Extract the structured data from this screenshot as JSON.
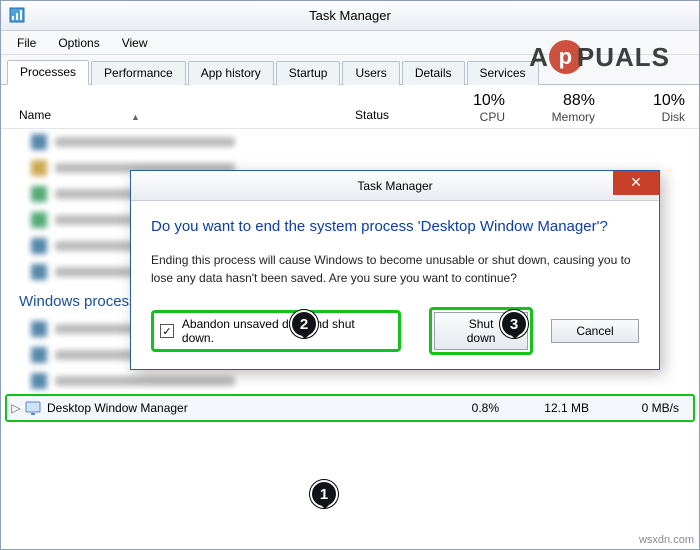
{
  "window": {
    "title": "Task Manager"
  },
  "menu": {
    "file": "File",
    "options": "Options",
    "view": "View"
  },
  "tabs": {
    "processes": "Processes",
    "performance": "Performance",
    "app_history": "App history",
    "startup": "Startup",
    "users": "Users",
    "details": "Details",
    "services": "Services"
  },
  "columns": {
    "name": "Name",
    "status": "Status",
    "cpu": {
      "value": "10%",
      "label": "CPU"
    },
    "memory": {
      "value": "88%",
      "label": "Memory"
    },
    "disk": {
      "value": "10%",
      "label": "Disk"
    }
  },
  "group_label": "Windows processes",
  "selected_process": {
    "name": "Desktop Window Manager",
    "cpu": "0.8%",
    "memory": "12.1 MB",
    "disk": "0 MB/s"
  },
  "dialog": {
    "title": "Task Manager",
    "main": "Do you want to end the system process 'Desktop Window Manager'?",
    "desc": "Ending this process will cause Windows to become unusable or shut down, causing you to lose any data hasn't been saved. Are you sure you want to continue?",
    "checkbox_label": "Abandon unsaved data and shut down.",
    "checkbox_checked": "✓",
    "btn_shutdown": "Shut down",
    "btn_cancel": "Cancel"
  },
  "annotations": {
    "one": "1",
    "two": "2",
    "three": "3"
  },
  "watermark": {
    "text_pre": "A",
    "text_post": "PUALS"
  },
  "credit": "wsxdn.com"
}
